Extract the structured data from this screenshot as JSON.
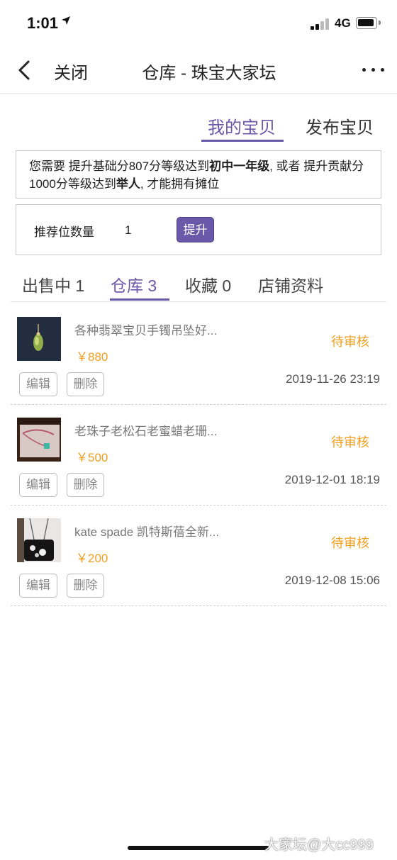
{
  "status_bar": {
    "time": "1:01",
    "network": "4G"
  },
  "navbar": {
    "close_label": "关闭",
    "title": "仓库 - 珠宝大家坛"
  },
  "top_tabs": [
    {
      "label": "我的宝贝",
      "active": true
    },
    {
      "label": "发布宝贝",
      "active": false
    }
  ],
  "notice": {
    "prefix": "您需要 提升基础分807分等级达到",
    "level1": "初中一年级",
    "middle": ", 或者 提升贡献分1000分等级达到",
    "level2": "举人",
    "suffix": ", 才能拥有摊位"
  },
  "recommend": {
    "label": "推荐位数量",
    "value": "1",
    "button": "提升"
  },
  "store_tabs": [
    {
      "label": "出售中 1",
      "active": false
    },
    {
      "label": "仓库 3",
      "active": true
    },
    {
      "label": "收藏 0",
      "active": false
    },
    {
      "label": "店铺资料",
      "active": false
    }
  ],
  "items": [
    {
      "title": "各种翡翠宝贝手镯吊坠好...",
      "price": "￥880",
      "status": "待审核",
      "date": "2019-11-26 23:19",
      "edit_label": "编辑",
      "delete_label": "删除"
    },
    {
      "title": "老珠子老松石老蜜蜡老珊...",
      "price": "￥500",
      "status": "待审核",
      "date": "2019-12-01 18:19",
      "edit_label": "编辑",
      "delete_label": "删除"
    },
    {
      "title": "kate spade 凯特斯蓓全新...",
      "price": "￥200",
      "status": "待审核",
      "date": "2019-12-08 15:06",
      "edit_label": "编辑",
      "delete_label": "删除"
    }
  ],
  "watermark": "大家坛@大cc999",
  "colors": {
    "accent": "#6a58a8",
    "price": "#f0a020",
    "status": "#f0a020"
  }
}
